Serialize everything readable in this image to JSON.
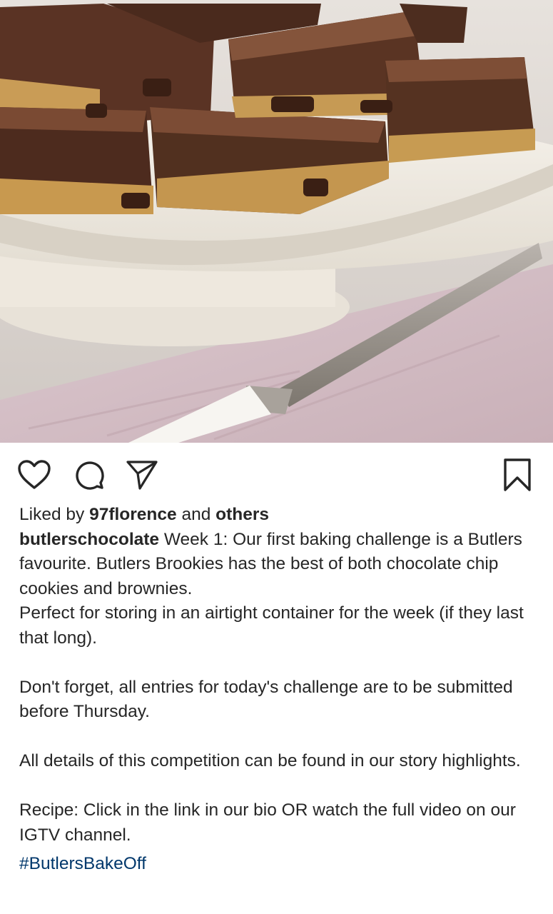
{
  "post": {
    "image_alt": "Butlers Brookies on a cake stand with a knife",
    "actions": {
      "like": "heart-icon",
      "comment": "comment-icon",
      "share": "send-icon",
      "save": "bookmark-icon"
    },
    "likes": {
      "prefix": "Liked by",
      "user": "97florence",
      "conjunction": "and",
      "others": "others"
    },
    "caption": {
      "username": "butlerschocolate",
      "text": " Week 1: Our first baking challenge is a Butlers favourite. Butlers Brookies has the best of both chocolate chip cookies and brownies.\nPerfect for storing in an airtight container for the week (if they last that long).\n\nDon't forget, all entries for today's challenge are to be submitted before Thursday.\n\nAll details of this competition can be found in our story highlights.\n\nRecipe: Click in the link in our bio OR watch the full video on our IGTV channel.\n"
    },
    "hashtag": "#ButlersBakeOff"
  },
  "colors": {
    "text": "#262626",
    "hashtag": "#00376b"
  }
}
